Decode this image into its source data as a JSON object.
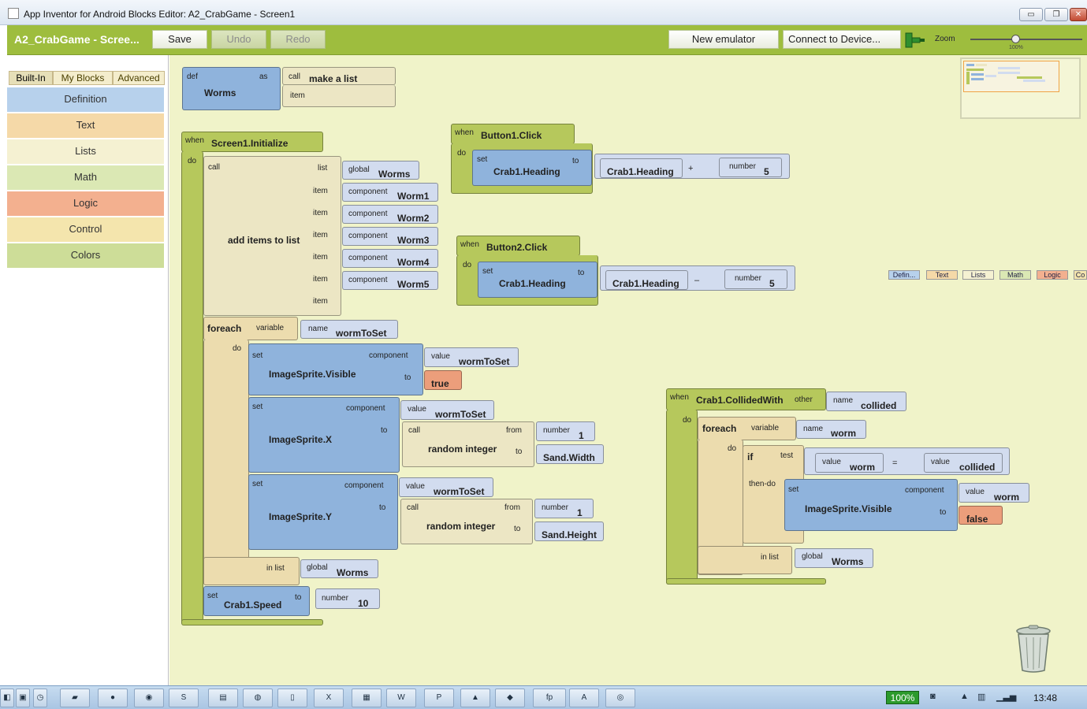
{
  "window": {
    "title": "App Inventor for Android Blocks Editor: A2_CrabGame - Screen1",
    "min": "▭",
    "restore": "❐",
    "close": "✕"
  },
  "toolbar": {
    "app_title": "A2_CrabGame - Scree...",
    "save": "Save",
    "undo": "Undo",
    "redo": "Redo",
    "new_emulator": "New emulator",
    "connect": "Connect to Device...",
    "zoom_label": "Zoom",
    "zoom_pct": "100%",
    "zoom_level": 0.37
  },
  "palette": {
    "tabs": [
      "Built-In",
      "My Blocks",
      "Advanced"
    ],
    "drawers": [
      {
        "label": "Definition",
        "color": "#b7d1ec"
      },
      {
        "label": "Text",
        "color": "#f5d9a8"
      },
      {
        "label": "Lists",
        "color": "#f5f1d2"
      },
      {
        "label": "Math",
        "color": "#dbe8b4"
      },
      {
        "label": "Logic",
        "color": "#f3b08f"
      },
      {
        "label": "Control",
        "color": "#f4e5ad"
      },
      {
        "label": "Colors",
        "color": "#cddd98"
      }
    ]
  },
  "legend": [
    "Defin...",
    "Text",
    "Lists",
    "Math",
    "Logic",
    "Co"
  ],
  "blocks": {
    "def": "def",
    "as": "as",
    "worms": "Worms",
    "call": "call",
    "make_a_list": "make a list",
    "item": "item",
    "when": "when",
    "do": "do",
    "screen_init": "Screen1.Initialize",
    "list": "list",
    "global": "global",
    "component": "component",
    "worm1": "Worm1",
    "worm2": "Worm2",
    "worm3": "Worm3",
    "worm4": "Worm4",
    "worm5": "Worm5",
    "add_items": "add items to list",
    "foreach": "foreach",
    "variable": "variable",
    "name": "name",
    "wormtoset": "wormToSet",
    "set": "set",
    "value": "value",
    "to": "to",
    "sprite_visible": "ImageSprite.Visible",
    "true": "true",
    "sprite_x": "ImageSprite.X",
    "from": "from",
    "number": "number",
    "one": "1",
    "random_integer": "random integer",
    "sand_width": "Sand.Width",
    "sprite_y": "ImageSprite.Y",
    "sand_height": "Sand.Height",
    "in_list": "in list",
    "crab_speed": "Crab1.Speed",
    "ten": "10",
    "button1_click": "Button1.Click",
    "crab_heading": "Crab1.Heading",
    "plus": "+",
    "five": "5",
    "button2_click": "Button2.Click",
    "minus": "–",
    "crab_collided": "Crab1.CollidedWith",
    "other": "other",
    "collided": "collided",
    "worm": "worm",
    "if": "if",
    "test": "test",
    "equals": "=",
    "then_do": "then-do",
    "false": "false"
  },
  "taskbar": {
    "battery": "100%",
    "clock": "13:48"
  }
}
